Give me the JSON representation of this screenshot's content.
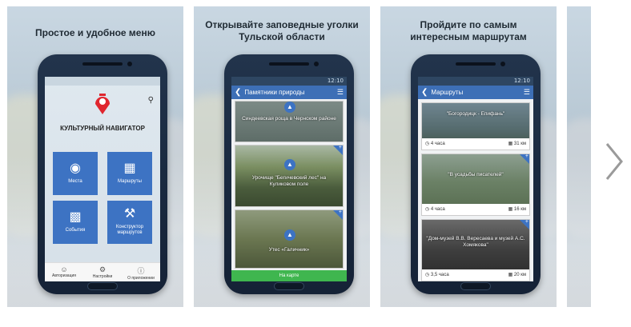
{
  "cards": [
    {
      "caption": "Простое и удобное меню",
      "brand": "КУЛЬТУРНЫЙ НАВИГАТОР",
      "tiles": [
        {
          "label": "Места",
          "icon": "map-pin-icon"
        },
        {
          "label": "Маршруты",
          "icon": "map-icon"
        },
        {
          "label": "События",
          "icon": "calendar-icon"
        },
        {
          "label": "Конструктор маршрутов",
          "icon": "wrench-icon"
        }
      ],
      "nav": [
        {
          "label": "Авторизация",
          "icon": "user-icon"
        },
        {
          "label": "Настройки",
          "icon": "gear-icon"
        },
        {
          "label": "О приложении",
          "icon": "info-icon"
        }
      ]
    },
    {
      "caption_line1": "Открывайте заповедные уголки",
      "caption_line2": "Тульской области",
      "status_time": "12:10",
      "appbar_title": "Памятники природы",
      "items": [
        "Синдеевская роща в Чернском районе",
        "Урочище \"Бегичевский лес\" на Куликовом поле",
        "Утес «Галичник»"
      ],
      "map_button": "На карте"
    },
    {
      "caption_line1": "Пройдите по самым",
      "caption_line2": "интересным маршрутам",
      "status_time": "12:10",
      "appbar_title": "Маршруты",
      "routes": [
        {
          "title": "\"Богородицк - Епифань\"",
          "time": "4 часа",
          "distance": "31 км"
        },
        {
          "title": "\"В усадьбы писателей\"",
          "time": "4 часа",
          "distance": "16 км"
        },
        {
          "title": "\"Дом-музей В.В. Вересаева и музей А.С. Хомякова\"",
          "time": "3,5 часа",
          "distance": "20 км"
        }
      ]
    }
  ],
  "colors": {
    "accent": "#3d73c3",
    "appbar": "#3d6fb6",
    "green": "#3fb64f",
    "logo_red": "#e0262e"
  }
}
